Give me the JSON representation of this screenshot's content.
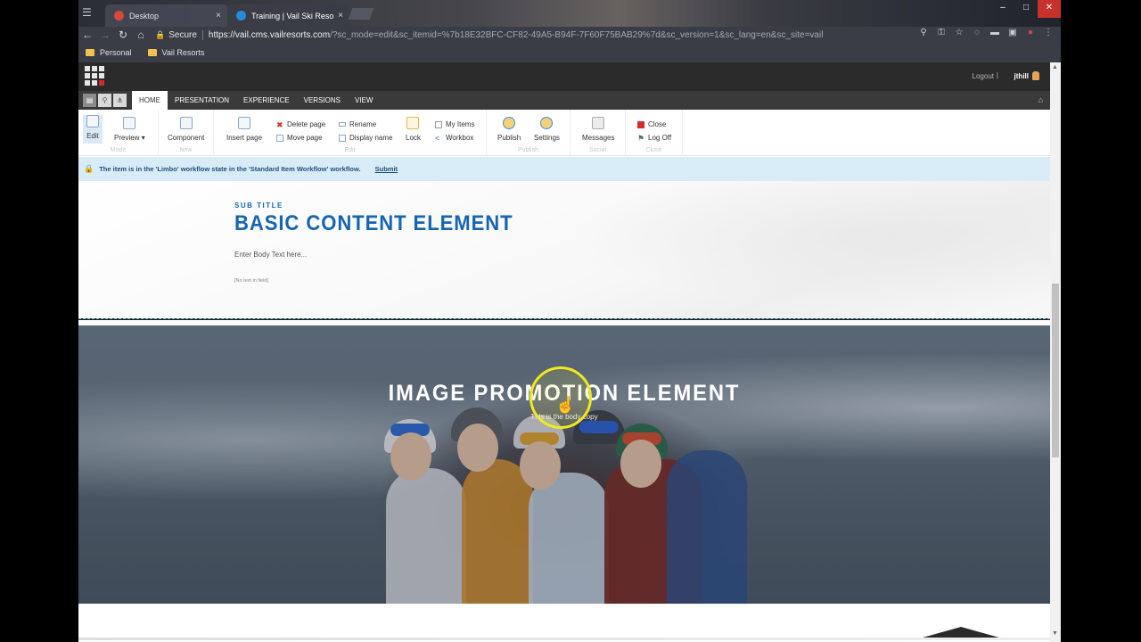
{
  "browser": {
    "tabs": [
      {
        "label": "Desktop",
        "close": "×"
      },
      {
        "label": "Training | Vail Ski Resort",
        "close": "×"
      }
    ],
    "address": {
      "secure_label": "Secure",
      "host": "https://vail.cms.vailresorts.com",
      "path": "/?sc_mode=edit&sc_itemid=%7b18E32BFC-CF82-49A5-B94F-7F60F75BAB29%7d&sc_version=1&sc_lang=en&sc_site=vail"
    },
    "bookmarks": [
      {
        "label": "Personal"
      },
      {
        "label": "Vail Resorts"
      }
    ]
  },
  "cms": {
    "header": {
      "logout": "Logout",
      "divider": "|",
      "username": "jthill"
    },
    "ribbon_tabs": [
      "HOME",
      "PRESENTATION",
      "EXPERIENCE",
      "VERSIONS",
      "VIEW"
    ],
    "ribbon": {
      "edit": "Edit",
      "preview": "Preview",
      "mode_title": "Mode",
      "component": "Component",
      "new_title": "New",
      "insert_page": "Insert page",
      "delete_page": "Delete page",
      "move_page": "Move page",
      "rename": "Rename",
      "display_name": "Display name",
      "lock": "Lock",
      "my_items": "My Items",
      "workbox": "Workbox",
      "edit_title": "Edit",
      "publish": "Publish",
      "settings": "Settings",
      "publish_title": "Publish",
      "messages": "Messages",
      "social_title": "Social",
      "close": "Close",
      "log_off": "Log Off",
      "close_title": "Close"
    },
    "notice": {
      "text": "The item is in the 'Limbo' workflow state in the 'Standard Item Workflow' workflow.",
      "action": "Submit"
    }
  },
  "content": {
    "basic": {
      "sub_title": "SUB TITLE",
      "title": "BASIC CONTENT ELEMENT",
      "body": "Enter Body Text here...",
      "empty_field": "[No text in field]"
    },
    "promo": {
      "title": "IMAGE PROMOTION ELEMENT",
      "copy": "This is the body copy"
    }
  },
  "colors": {
    "accent": "#1565b4",
    "notice_bg": "#d8ecf8",
    "cms_dark": "#2b2b2b",
    "cursor_ring": "#f1e81f"
  }
}
